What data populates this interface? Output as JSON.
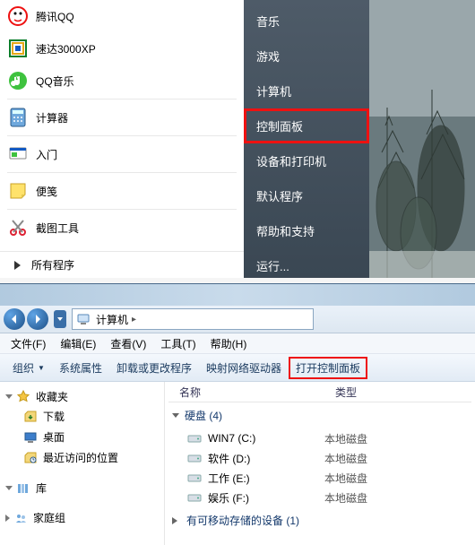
{
  "start_menu": {
    "left_items": [
      {
        "label": "腾讯QQ",
        "icon": "qq-icon"
      },
      {
        "label": "速达3000XP",
        "icon": "suda-icon"
      },
      {
        "label": "QQ音乐",
        "icon": "qqmusic-icon"
      },
      {
        "label": "计算器",
        "icon": "calculator-icon"
      },
      {
        "label": "入门",
        "icon": "getting-started-icon"
      },
      {
        "label": "便笺",
        "icon": "sticky-notes-icon"
      },
      {
        "label": "截图工具",
        "icon": "snipping-tool-icon"
      }
    ],
    "all_programs": "所有程序",
    "right_items": [
      {
        "label": "音乐"
      },
      {
        "label": "游戏"
      },
      {
        "label": "计算机"
      },
      {
        "label": "控制面板",
        "highlight": true
      },
      {
        "label": "设备和打印机"
      },
      {
        "label": "默认程序"
      },
      {
        "label": "帮助和支持"
      },
      {
        "label": "运行..."
      }
    ]
  },
  "explorer": {
    "breadcrumb": {
      "root": "计算机"
    },
    "menubar": [
      {
        "label": "文件(F)"
      },
      {
        "label": "编辑(E)"
      },
      {
        "label": "查看(V)"
      },
      {
        "label": "工具(T)"
      },
      {
        "label": "帮助(H)"
      }
    ],
    "toolbar": {
      "organize": "组织",
      "sys_props": "系统属性",
      "uninstall": "卸载或更改程序",
      "map_drive": "映射网络驱动器",
      "control_panel": "打开控制面板"
    },
    "nav": {
      "favorites": {
        "label": "收藏夹",
        "items": [
          {
            "label": "下载",
            "icon": "downloads-icon"
          },
          {
            "label": "桌面",
            "icon": "desktop-icon"
          },
          {
            "label": "最近访问的位置",
            "icon": "recent-icon"
          }
        ]
      },
      "libraries": {
        "label": "库"
      },
      "homegroup": {
        "label": "家庭组"
      }
    },
    "columns": {
      "name": "名称",
      "type": "类型"
    },
    "groups": {
      "hdd": {
        "title": "硬盘 (4)",
        "drives": [
          {
            "name": "WIN7 (C:)",
            "type": "本地磁盘"
          },
          {
            "name": "软件 (D:)",
            "type": "本地磁盘"
          },
          {
            "name": "工作 (E:)",
            "type": "本地磁盘"
          },
          {
            "name": "娱乐 (F:)",
            "type": "本地磁盘"
          }
        ]
      },
      "removable": {
        "title": "有可移动存储的设备 (1)"
      }
    }
  }
}
